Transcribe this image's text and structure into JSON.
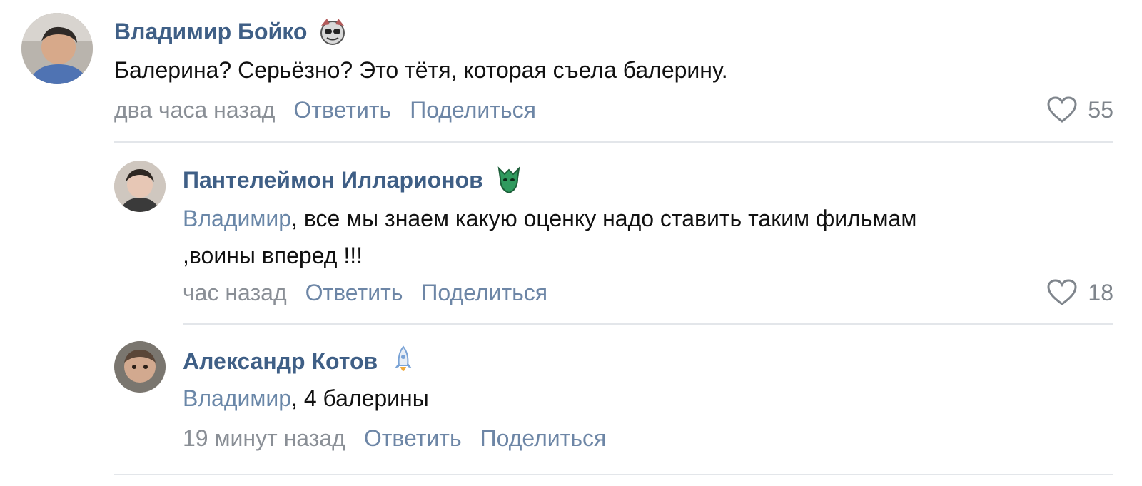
{
  "comments": [
    {
      "author": "Владимир Бойко",
      "badge_icon": "cartoon-face-icon",
      "mention": "",
      "text": "Балерина? Серьёзно? Это тётя, которая съела балерину.",
      "text_line2": "",
      "time": "два часа назад",
      "reply_label": "Ответить",
      "share_label": "Поделиться",
      "likes": "55"
    },
    {
      "author": "Пантелеймон Илларионов",
      "badge_icon": "green-dragon-icon",
      "mention": "Владимир",
      "text": ", все мы знаем какую оценку надо ставить таким фильмам",
      "text_line2": ",воины вперед !!!",
      "time": "час назад",
      "reply_label": "Ответить",
      "share_label": "Поделиться",
      "likes": "18"
    },
    {
      "author": "Александр Котов",
      "badge_icon": "rocket-icon",
      "mention": "Владимир",
      "text": ", 4 балерины",
      "text_line2": "",
      "time": "19 минут назад",
      "reply_label": "Ответить",
      "share_label": "Поделиться",
      "likes": ""
    }
  ],
  "colors": {
    "author": "#3f5f86",
    "mention": "#6a87a8",
    "meta": "#8a8f96",
    "divider": "#e3e6ea"
  }
}
